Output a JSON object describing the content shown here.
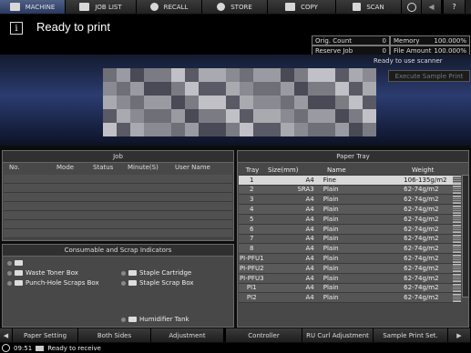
{
  "nav": {
    "tabs": [
      {
        "label": "MACHINE",
        "icon": "machine-icon"
      },
      {
        "label": "JOB LIST",
        "icon": "job-list-icon"
      },
      {
        "label": "RECALL",
        "icon": "recall-icon"
      },
      {
        "label": "STORE",
        "icon": "store-icon"
      },
      {
        "label": "COPY",
        "icon": "copy-icon"
      },
      {
        "label": "SCAN",
        "icon": "scan-icon"
      }
    ],
    "extra_icons": [
      "globe-icon",
      "speaker-icon",
      "help-icon"
    ],
    "help_label": "?"
  },
  "message": {
    "info_icon_label": "i",
    "text": "Ready to print"
  },
  "counters": {
    "orig_count_label": "Orig. Count",
    "orig_count_value": "0",
    "memory_label": "Memory",
    "memory_value": "100.000%",
    "reserve_job_label": "Reserve Job",
    "reserve_job_value": "0",
    "file_amount_label": "File Amount",
    "file_amount_value": "100.000%"
  },
  "scanner_status": "Ready to use scanner",
  "execute_sample_print": "Execute Sample Print",
  "job_panel": {
    "title": "Job",
    "columns": [
      "No.",
      "Mode",
      "Status",
      "Minute(S)",
      "User Name"
    ]
  },
  "consumables": {
    "title": "Consumable and Scrap Indicators",
    "items": [
      {
        "label": "",
        "icon": "toner-icon"
      },
      {
        "label": "Waste Toner Box",
        "icon": "waste-toner-icon"
      },
      {
        "label": "Punch-Hole Scraps Box",
        "icon": "punch-scraps-icon"
      },
      {
        "label": "Staple Cartridge",
        "icon": "staple-icon"
      },
      {
        "label": "Staple Scrap Box",
        "icon": "staple-scrap-icon"
      },
      {
        "label": "Humidifier Tank",
        "icon": "humidifier-icon"
      }
    ]
  },
  "paper_tray": {
    "title": "Paper Tray",
    "columns": [
      "Tray",
      "Size(mm)",
      "Name",
      "Weight"
    ],
    "rows": [
      {
        "tray": "1",
        "size": "A4",
        "name": "Fine",
        "weight": "106-135g/m2"
      },
      {
        "tray": "2",
        "size": "SRA3",
        "name": "Plain",
        "weight": "62-74g/m2"
      },
      {
        "tray": "3",
        "size": "A4",
        "name": "Plain",
        "weight": "62-74g/m2"
      },
      {
        "tray": "4",
        "size": "A4",
        "name": "Plain",
        "weight": "62-74g/m2"
      },
      {
        "tray": "5",
        "size": "A4",
        "name": "Plain",
        "weight": "62-74g/m2"
      },
      {
        "tray": "6",
        "size": "A4",
        "name": "Plain",
        "weight": "62-74g/m2"
      },
      {
        "tray": "7",
        "size": "A4",
        "name": "Plain",
        "weight": "62-74g/m2"
      },
      {
        "tray": "8",
        "size": "A4",
        "name": "Plain",
        "weight": "62-74g/m2"
      },
      {
        "tray": "PI-PFU1",
        "size": "A4",
        "name": "Plain",
        "weight": "62-74g/m2"
      },
      {
        "tray": "PI-PFU2",
        "size": "A4",
        "name": "Plain",
        "weight": "62-74g/m2"
      },
      {
        "tray": "PI-PFU3",
        "size": "A4",
        "name": "Plain",
        "weight": "62-74g/m2"
      },
      {
        "tray": "PI1",
        "size": "A4",
        "name": "Plain",
        "weight": "62-74g/m2"
      },
      {
        "tray": "PI2",
        "size": "A4",
        "name": "Plain",
        "weight": "62-74g/m2"
      }
    ]
  },
  "bottom_bar": {
    "buttons": [
      "Paper Setting",
      "Both Sides",
      "Adjustment",
      "Controller",
      "RU Curl Adjustment",
      "Sample Print Set."
    ]
  },
  "status_bar": {
    "time": "09:51",
    "text": "Ready to receive"
  },
  "colors": {
    "active_tab": "#2a3960",
    "panel": "#484848",
    "selected_row": "#d8d8d8"
  }
}
